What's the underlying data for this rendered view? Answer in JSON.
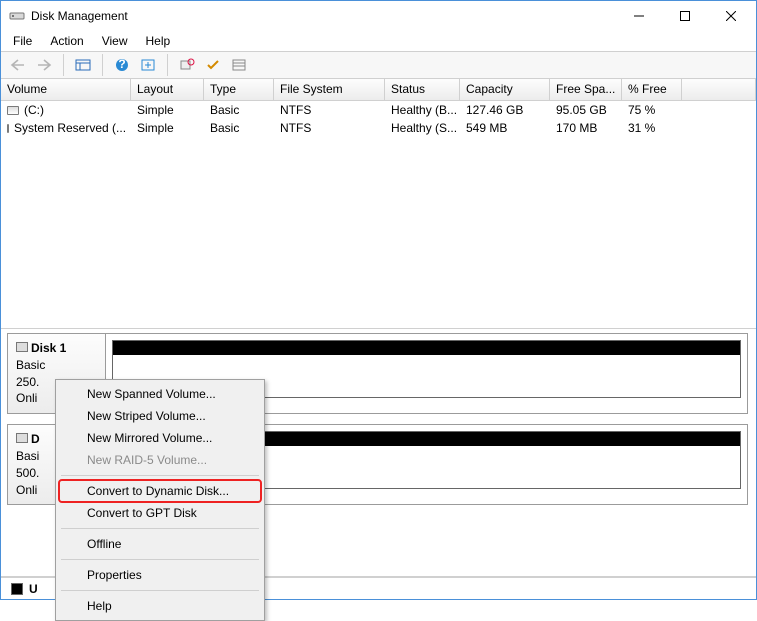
{
  "window": {
    "title": "Disk Management"
  },
  "menu": {
    "file": "File",
    "action": "Action",
    "view": "View",
    "help": "Help"
  },
  "columns": {
    "volume": "Volume",
    "layout": "Layout",
    "type": "Type",
    "fs": "File System",
    "status": "Status",
    "capacity": "Capacity",
    "free": "Free Spa...",
    "pfree": "% Free"
  },
  "volumes": [
    {
      "name": "(C:)",
      "layout": "Simple",
      "type": "Basic",
      "fs": "NTFS",
      "status": "Healthy (B...",
      "capacity": "127.46 GB",
      "free": "95.05 GB",
      "pfree": "75 %"
    },
    {
      "name": "System Reserved (...",
      "layout": "Simple",
      "type": "Basic",
      "fs": "NTFS",
      "status": "Healthy (S...",
      "capacity": "549 MB",
      "free": "170 MB",
      "pfree": "31 %"
    }
  ],
  "disks": [
    {
      "name": "Disk 1",
      "type": "Basic",
      "size": "250.",
      "status": "Onli"
    },
    {
      "name": "D",
      "type": "Basi",
      "size": "500.",
      "status": "Onli"
    }
  ],
  "statusbar": {
    "label": "U"
  },
  "contextMenu": {
    "spanned": "New Spanned Volume...",
    "striped": "New Striped Volume...",
    "mirrored": "New Mirrored Volume...",
    "raid5": "New RAID-5 Volume...",
    "toDynamic": "Convert to Dynamic Disk...",
    "toGpt": "Convert to GPT Disk",
    "offline": "Offline",
    "properties": "Properties",
    "help": "Help"
  }
}
